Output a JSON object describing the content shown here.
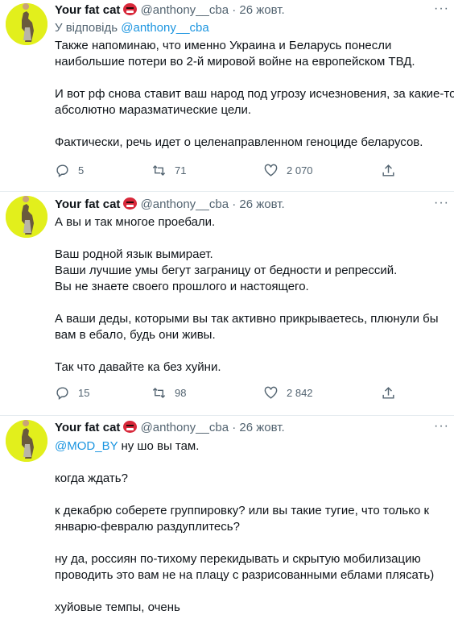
{
  "tweets": [
    {
      "name": "Your fat cat",
      "handle": "@anthony__cba",
      "sep": "·",
      "date": "26 жовт.",
      "reply_prefix": "У відповідь",
      "reply_to": "@anthony__cba",
      "paragraphs": [
        [
          "Также напоминаю, что именно Украина и Беларусь понесли",
          "наибольшие потери во 2-й мировой войне на европейском ТВД."
        ],
        [
          "И вот рф снова ставит ваш народ под угрозу исчезновения, за какие-то",
          "абсолютно маразматические цели."
        ],
        [
          "Фактически, речь идет о целенаправленном геноциде беларусов."
        ]
      ],
      "replies": "5",
      "retweets": "71",
      "likes": "2 070"
    },
    {
      "name": "Your fat cat",
      "handle": "@anthony__cba",
      "sep": "·",
      "date": "26 жовт.",
      "paragraphs": [
        [
          "А вы и так многое проебали."
        ],
        [
          "Ваш родной язык вымирает.",
          "Ваши лучшие умы бегут заграницу от бедности и репрессий.",
          "Вы не знаете своего прошлого и настоящего."
        ],
        [
          "А ваши деды, которыми вы так активно прикрываетесь, плюнули бы",
          "вам в ебало, будь они живы."
        ],
        [
          "Так что давайте ка без хуйни."
        ]
      ],
      "replies": "15",
      "retweets": "98",
      "likes": "2 842"
    },
    {
      "name": "Your fat cat",
      "handle": "@anthony__cba",
      "sep": "·",
      "date": "26 жовт.",
      "mention": "@MOD_BY",
      "first_line_rest": " ну шо вы там.",
      "paragraphs": [
        [
          "когда ждать?"
        ],
        [
          "к декабрю соберете группировку? или вы такие тугие, что только к",
          "январю-февралю раздуплитесь?"
        ],
        [
          "ну да, россиян по-тихому перекидывать и скрытую мобилизацию",
          "проводить это вам не на плацу с разрисованными еблами плясать)"
        ],
        [
          "хуйовые темпы, очень"
        ]
      ]
    }
  ],
  "icons": {
    "reply": "reply-bubble-icon",
    "retweet": "retweet-icon",
    "like": "heart-icon",
    "share": "share-icon",
    "more": "more-dots-icon",
    "emoji": "angry-face-emoji-icon"
  },
  "more_glyph": "···",
  "colors": {
    "link": "#1b95e0",
    "muted": "#536471",
    "avatar_bg": "#e2ef1c"
  }
}
